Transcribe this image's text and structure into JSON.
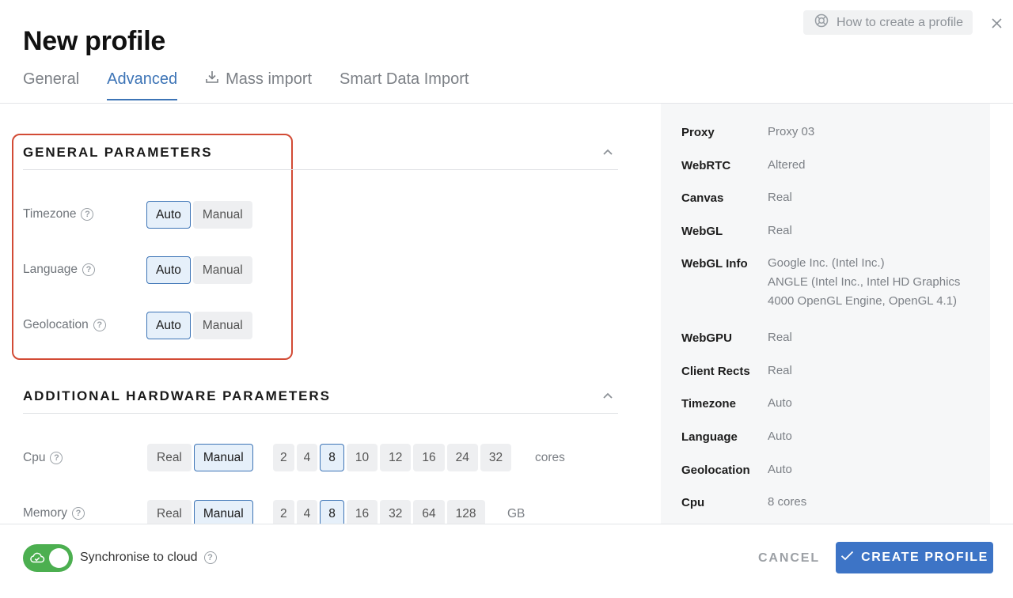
{
  "header": {
    "title": "New profile",
    "help_label": "How to create a profile",
    "tabs": [
      {
        "label": "General"
      },
      {
        "label": "Advanced"
      },
      {
        "label": "Mass import"
      },
      {
        "label": "Smart Data Import"
      }
    ],
    "active_tab": "Advanced"
  },
  "general_parameters": {
    "title": "GENERAL PARAMETERS",
    "rows": [
      {
        "label": "Timezone",
        "options": [
          "Auto",
          "Manual"
        ],
        "selected": "Auto"
      },
      {
        "label": "Language",
        "options": [
          "Auto",
          "Manual"
        ],
        "selected": "Auto"
      },
      {
        "label": "Geolocation",
        "options": [
          "Auto",
          "Manual"
        ],
        "selected": "Auto"
      }
    ]
  },
  "hardware_parameters": {
    "title": "ADDITIONAL HARDWARE PARAMETERS",
    "cpu": {
      "label": "Cpu",
      "modes": [
        "Real",
        "Manual"
      ],
      "mode_selected": "Manual",
      "values": [
        "2",
        "4",
        "8",
        "10",
        "12",
        "16",
        "24",
        "32"
      ],
      "value_selected": "8",
      "unit": "cores"
    },
    "memory": {
      "label": "Memory",
      "modes": [
        "Real",
        "Manual"
      ],
      "mode_selected": "Manual",
      "values": [
        "2",
        "4",
        "8",
        "16",
        "32",
        "64",
        "128"
      ],
      "value_selected": "8",
      "unit": "GB"
    }
  },
  "summary": [
    {
      "key": "Proxy",
      "value": "Proxy 03"
    },
    {
      "key": "WebRTC",
      "value": "Altered"
    },
    {
      "key": "Canvas",
      "value": "Real"
    },
    {
      "key": "WebGL",
      "value": "Real"
    },
    {
      "key": "WebGL Info",
      "value": "Google Inc. (Intel Inc.)",
      "value2": "ANGLE (Intel Inc., Intel HD Graphics 4000 OpenGL Engine, OpenGL 4.1)"
    },
    {
      "key": "WebGPU",
      "value": "Real"
    },
    {
      "key": "Client Rects",
      "value": "Real"
    },
    {
      "key": "Timezone",
      "value": "Auto"
    },
    {
      "key": "Language",
      "value": "Auto"
    },
    {
      "key": "Geolocation",
      "value": "Auto"
    },
    {
      "key": "Cpu",
      "value": "8 cores"
    }
  ],
  "footer": {
    "sync_label": "Synchronise to cloud",
    "sync_enabled": true,
    "cancel_label": "CANCEL",
    "create_label": "CREATE PROFILE"
  },
  "colors": {
    "accent": "#3d74b6",
    "highlight_border": "#d24b35",
    "toggle_on": "#4caf50",
    "primary_button": "#3d74c6"
  }
}
